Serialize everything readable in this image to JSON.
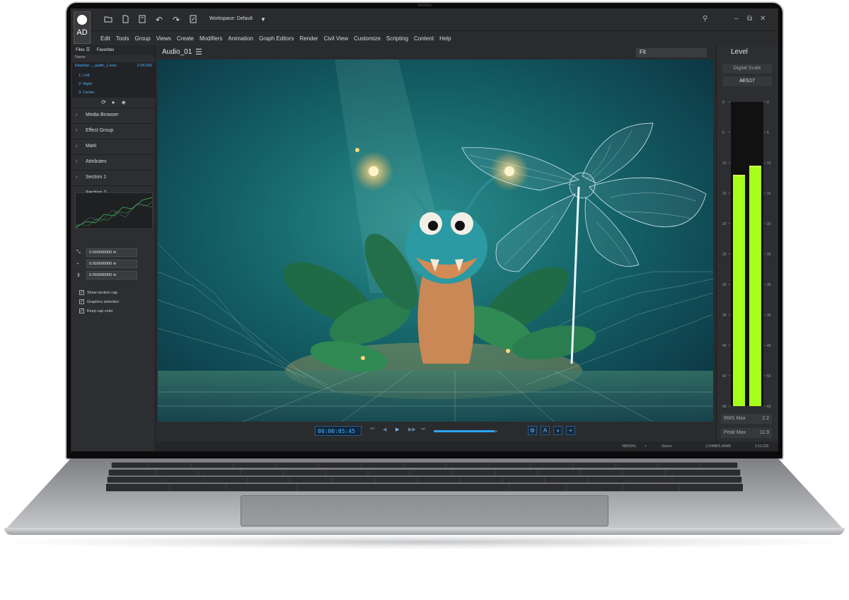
{
  "app": {
    "logo_text": "AD",
    "workspace_label": "Workspace: Default",
    "menu": [
      "Edit",
      "Tools",
      "Group",
      "Views",
      "Create",
      "Modifiers",
      "Animation",
      "Graph Editors",
      "Render",
      "Civil View",
      "Customize",
      "Scripting",
      "Content",
      "Help"
    ]
  },
  "left_panel": {
    "tabs": [
      "Files",
      "Favorites"
    ],
    "name_header": "Name",
    "file_name": "Elephan..._audio_1.wav",
    "file_duration": "2:34.500",
    "channels": [
      "1: Left",
      "2: Right",
      "3: Center"
    ],
    "sections": [
      "Media Browser",
      "Effect Group",
      "Mark",
      "Attributes",
      "Section 1",
      "Section 2"
    ],
    "fields": [
      "0.000000000 m",
      "0.000000000 m",
      "0.000000000 m"
    ],
    "checkboxes": [
      "Show section cap",
      "Graphics selection",
      "Keep cap color"
    ]
  },
  "viewport": {
    "title": "Audio_01",
    "fit_label": "Fit"
  },
  "transport": {
    "timecode": "00:00:05:45",
    "progress": 0.95
  },
  "status": {
    "rate": "48000Hz",
    "mode": "Stereo",
    "memory": "2.00MB/5.40MB",
    "time": "2:10.230"
  },
  "level_panel": {
    "title": "Level",
    "scale_mode": "Digital Scale",
    "standard": "AES17",
    "scale_ticks": [
      "0",
      "5",
      "10",
      "15",
      "20",
      "25",
      "30",
      "35",
      "40",
      "50",
      "60"
    ],
    "left_level": 0.76,
    "right_level": 0.79,
    "rms_label": "RMS Max",
    "rms_value": "2.2",
    "peak_label": "Peak Max",
    "peak_value": "11.9",
    "meter_color": "#a6ff1a"
  }
}
